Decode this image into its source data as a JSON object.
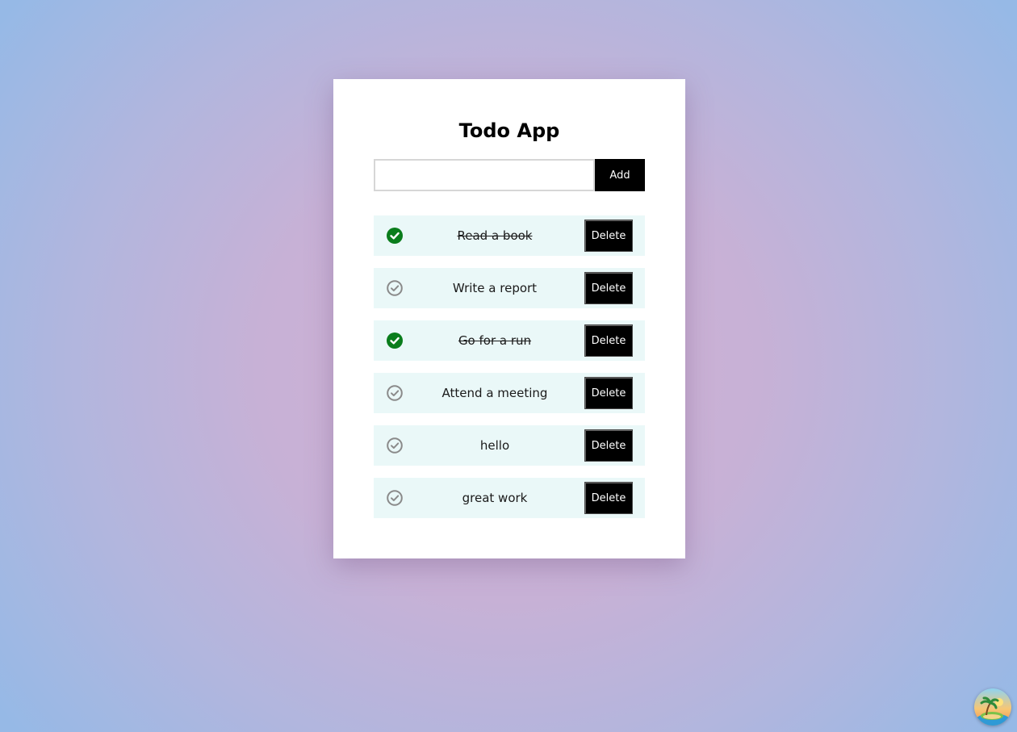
{
  "app": {
    "title": "Todo App"
  },
  "input": {
    "value": "",
    "placeholder": "",
    "add_label": "Add"
  },
  "todos": [
    {
      "text": "Read a book",
      "completed": true,
      "delete_label": "Delete"
    },
    {
      "text": "Write a report",
      "completed": false,
      "delete_label": "Delete"
    },
    {
      "text": "Go for a run",
      "completed": true,
      "delete_label": "Delete"
    },
    {
      "text": "Attend a meeting",
      "completed": false,
      "delete_label": "Delete"
    },
    {
      "text": "hello",
      "completed": false,
      "delete_label": "Delete"
    },
    {
      "text": "great work",
      "completed": false,
      "delete_label": "Delete"
    }
  ],
  "icons": {
    "completed": "check-circle-filled-icon",
    "incomplete": "check-circle-outline-icon",
    "badge": "beach-island-icon"
  },
  "colors": {
    "completed_check": "#0a7d1c",
    "incomplete_check": "#8a8a8a",
    "button_bg": "#000000",
    "item_bg": "#eaf8f8"
  }
}
